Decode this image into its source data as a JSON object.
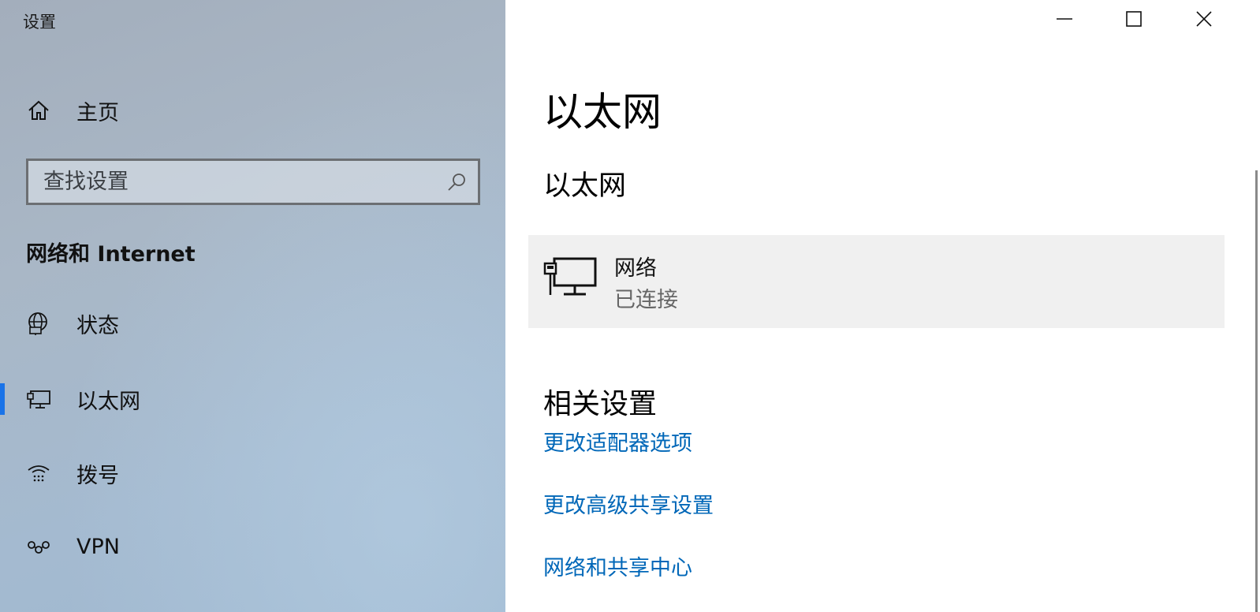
{
  "window": {
    "title": "设置"
  },
  "sidebar": {
    "home_label": "主页",
    "search_placeholder": "查找设置",
    "section_title": "网络和 Internet",
    "items": [
      {
        "label": "状态",
        "icon": "globe-icon"
      },
      {
        "label": "以太网",
        "icon": "ethernet-icon",
        "selected": true
      },
      {
        "label": "拨号",
        "icon": "dialup-icon"
      },
      {
        "label": "VPN",
        "icon": "vpn-icon"
      }
    ],
    "accent_color": "#1a73e8"
  },
  "main": {
    "page_title": "以太网",
    "subtitle": "以太网",
    "network": {
      "name": "网络",
      "status": "已连接"
    },
    "related_title": "相关设置",
    "links": [
      "更改适配器选项",
      "更改高级共享设置",
      "网络和共享中心"
    ],
    "link_color": "#0067b8"
  }
}
